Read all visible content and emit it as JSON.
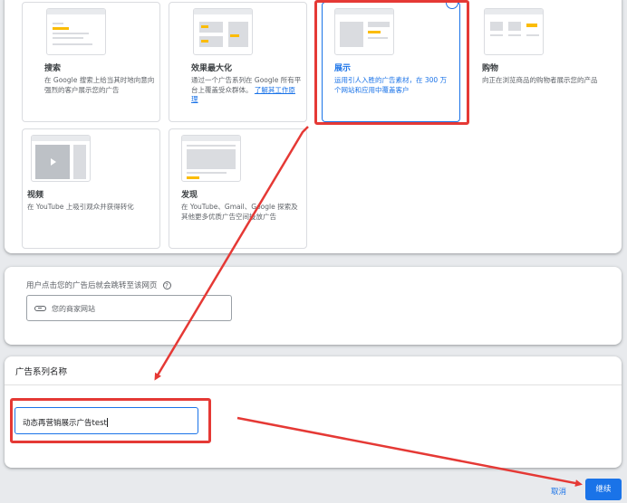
{
  "campaign_types": [
    {
      "title": "搜索",
      "desc": "在 Google 搜索上给当其时地向意向强烈的客户展示您的广告"
    },
    {
      "title": "效果最大化",
      "desc": "通过一个广告系列在 Google 所有平台上覆盖受众群体。",
      "link": "了解其工作原理"
    },
    {
      "title": "展示",
      "desc": "运用引人入胜的广告素材，在 300 万个网站和应用中覆盖客户",
      "selected": true
    },
    {
      "title": "购物",
      "desc": "向正在浏览商品的购物者展示您的产品"
    },
    {
      "title": "视频",
      "desc": "在 YouTube 上吸引观众并获得转化"
    },
    {
      "title": "发现",
      "desc": "在 YouTube、Gmail、Google 探索及其他更多优质广告空间投放广告"
    }
  ],
  "url_section": {
    "label": "用户点击您的广告后就会跳转至该网页",
    "help_icon": "?",
    "placeholder": "您的商家网站"
  },
  "name_section": {
    "header": "广告系列名称",
    "value": "动态再营销展示广告test"
  },
  "footer": {
    "cancel_label": "取消",
    "continue_label": "继续"
  },
  "selected_check": "✓",
  "colors": {
    "accent": "#1a73e8",
    "highlight": "#e53935",
    "thumb_yellow": "#fbbc04"
  }
}
